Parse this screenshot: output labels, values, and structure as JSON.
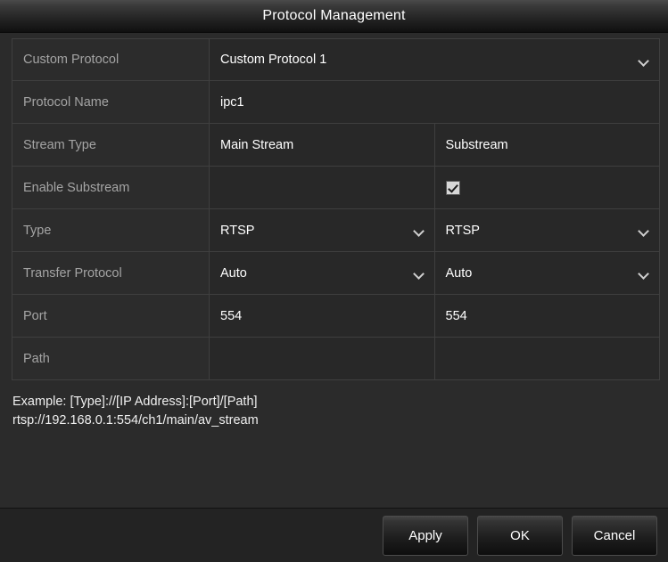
{
  "window": {
    "title": "Protocol Management"
  },
  "colors": {
    "dialog_bg": "#2b2b2b",
    "cell_bg": "#282828",
    "label_color": "#a4a4a4",
    "value_color": "#ffffff",
    "border": "#3f3f3f",
    "checkbox_fill": "#d7d7d7"
  },
  "form": {
    "columns": {
      "label_header": "",
      "main_header": "Main Stream",
      "sub_header": "Substream"
    },
    "rows": [
      {
        "key": "custom-protocol",
        "label": "Custom Protocol",
        "type": "select-span",
        "value": "Custom Protocol 1",
        "icon": "chevron-down-icon"
      },
      {
        "key": "protocol-name",
        "label": "Protocol Name",
        "type": "text-span",
        "value": "ipc1"
      },
      {
        "key": "stream-type",
        "label": "Stream Type",
        "type": "header-pair",
        "main": "Main Stream",
        "sub": "Substream"
      },
      {
        "key": "enable-substream",
        "label": "Enable Substream",
        "type": "checkbox-pair",
        "main": "",
        "main_checked": false,
        "main_has_checkbox": false,
        "sub": "",
        "sub_checked": true,
        "sub_has_checkbox": true
      },
      {
        "key": "type",
        "label": "Type",
        "type": "select-pair",
        "main": "RTSP",
        "sub": "RTSP",
        "icon": "chevron-down-icon"
      },
      {
        "key": "transfer-protocol",
        "label": "Transfer Protocol",
        "type": "select-pair",
        "main": "Auto",
        "sub": "Auto",
        "icon": "chevron-down-icon"
      },
      {
        "key": "port",
        "label": "Port",
        "type": "text-pair",
        "main": "554",
        "sub": "554"
      },
      {
        "key": "path",
        "label": "Path",
        "type": "text-pair",
        "main": "",
        "sub": ""
      }
    ]
  },
  "hint": {
    "line1": "Example: [Type]://[IP Address]:[Port]/[Path]",
    "line2": "rtsp://192.168.0.1:554/ch1/main/av_stream"
  },
  "footer": {
    "apply_label": "Apply",
    "ok_label": "OK",
    "cancel_label": "Cancel"
  }
}
